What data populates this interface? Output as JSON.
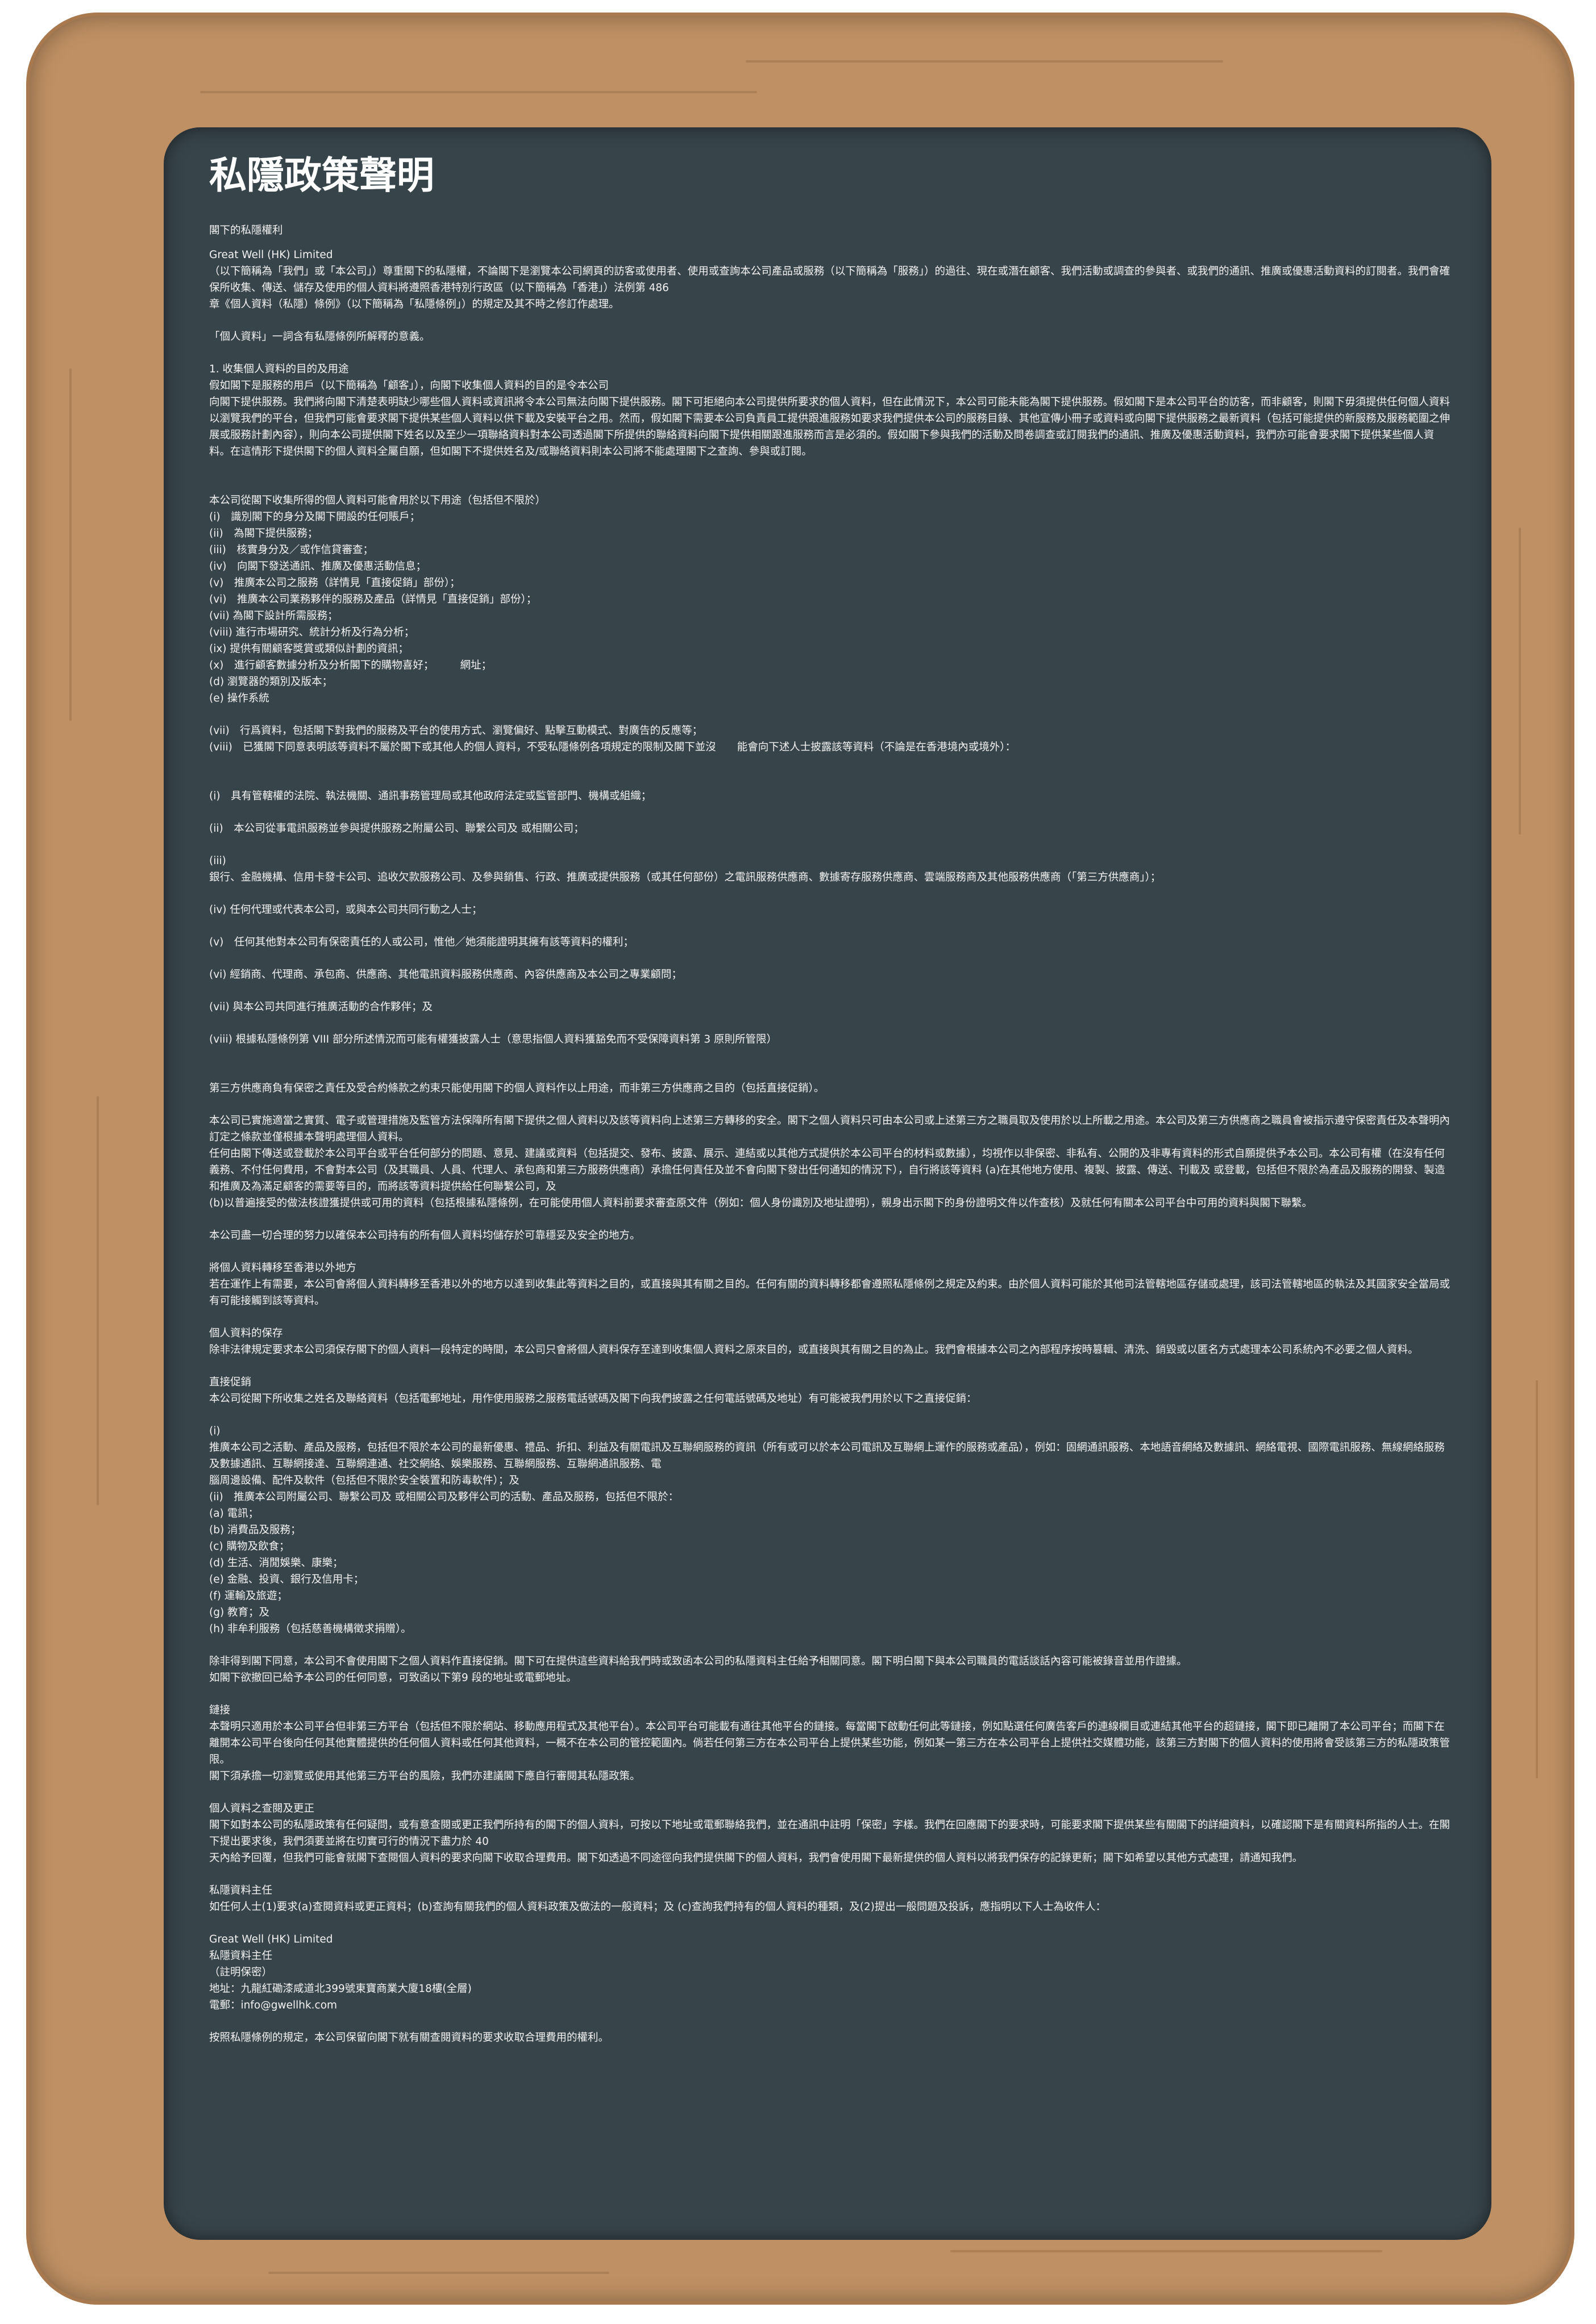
{
  "title": "私隱政策聲明",
  "blocks": [
    "閣下的私隱權利",
    "Great Well (HK) Limited\n（以下簡稱為「我們」或「本公司」）尊重閣下的私隱權，不論閣下是瀏覽本公司網頁的訪客或使用者、使用或查詢本公司產品或服務（以下簡稱為「服務」）的過往、現在或潛在顧客、我們活動或調查的參與者、或我們的通訊、推廣或優惠活動資料的訂閱者。我們會確保所收集、傳送、儲存及使用的個人資料將遵照香港特別行政區（以下簡稱為「香港」）法例第 486\n章《個人資料（私隱）條例》（以下簡稱為「私隱條例」）的規定及其不時之修訂作處理。",
    "「個人資料」一詞含有私隱條例所解釋的意義。",
    "1. 收集個人資料的目的及用途\n假如閣下是服務的用戶（以下簡稱為「顧客」），向閣下收集個人資料的目的是令本公司\n向閣下提供服務。我們將向閣下清楚表明缺少哪些個人資料或資訊將令本公司無法向閣下提供服務。閣下可拒絕向本公司提供所要求的個人資料，但在此情況下，本公司可能未能為閣下提供服務。假如閣下是本公司平台的訪客，而非顧客，則閣下毋須提供任何個人資料以瀏覽我們的平台，但我們可能會要求閣下提供某些個人資料以供下載及安裝平台之用。然而，假如閣下需要本公司負責員工提供跟進服務如要求我們提供本公司的服務目錄、其他宣傳小冊子或資料或向閣下提供服務之最新資料（包括可能提供的新服務及服務範圍之伸展或服務計劃內容），則向本公司提供閣下姓名以及至少一項聯絡資料對本公司透過閣下所提供的聯絡資料向閣下提供相關跟進服務而言是必須的。假如閣下參與我們的活動及問卷調查或訂閱我們的通訊、推廣及優惠活動資料，我們亦可能會要求閣下提供某些個人資料。在這情形下提供閣下的個人資料全屬自願，但如閣下不提供姓名及/或聯絡資料則本公司將不能處理閣下之查詢、參與或訂閱。",
    "\n本公司從閣下收集所得的個人資料可能會用於以下用途（包括但不限於）\n(i)　識別閣下的身分及閣下開設的任何賬戶；\n(ii)　為閣下提供服務；\n(iii)　核實身分及／或作信貸審查；\n(iv)　向閣下發送通訊、推廣及優惠活動信息；\n(v)　推廣本公司之服務（詳情見「直接促銷」部份）；\n(vi)　推廣本公司業務夥伴的服務及產品（詳情見「直接促銷」部份）；\n(vii) 為閣下設計所需服務；\n(viii) 進行市場研究、統計分析及行為分析；\n(ix) 提供有關顧客獎賞或類似計劃的資訊；\n(x)　進行顧客數據分析及分析閣下的購物喜好；　　　網址；\n(d) 瀏覽器的類別及版本；\n(e) 操作系統",
    "(vii)　行爲資料，包括閣下對我們的服務及平台的使用方式、瀏覽偏好、點擊互動模式、對廣告的反應等；\n(viii)　已獲閣下同意表明該等資料不屬於閣下或其他人的個人資料，不受私隱條例各項規定的限制及閣下並沒　　能會向下述人士披露該等資料（不論是在香港境內或境外）：",
    "\n(i)　具有管轄權的法院、執法機關、通訊事務管理局或其他政府法定或監管部門、機構或組織；",
    "(ii)　本公司從事電訊服務並參與提供服務之附屬公司、聯繫公司及 或相關公司；",
    "(iii)\n銀行、金融機構、信用卡發卡公司、追收欠款服務公司、及參與銷售、行政、推廣或提供服務（或其任何部份）之電訊服務供應商、數據寄存服務供應商、雲端服務商及其他服務供應商（「第三方供應商」）；",
    "(iv) 任何代理或代表本公司，或與本公司共同行動之人士；",
    "(v)　任何其他對本公司有保密責任的人或公司，惟他／她須能證明其擁有該等資料的權利；",
    "(vi) 經銷商、代理商、承包商、供應商、其他電訊資料服務供應商、內容供應商及本公司之專業顧問；",
    "(vii) 與本公司共同進行推廣活動的合作夥伴；及",
    "(viii) 根據私隱條例第 VIII 部分所述情況而可能有權獲披露人士（意思指個人資料獲豁免而不受保障資料第 3 原則所管限）",
    "\n第三方供應商負有保密之責任及受合約條款之約束只能使用閣下的個人資料作以上用途，而非第三方供應商之目的（包括直接促銷）。",
    "本公司已實施適當之實質、電子或管理措施及監管方法保障所有閣下提供之個人資料以及該等資料向上述第三方轉移的安全。閣下之個人資料只可由本公司或上述第三方之職員取及使用於以上所載之用途。本公司及第三方供應商之職員會被指示遵守保密責任及本聲明內訂定之條款並僅根據本聲明處理個人資料。\n任何由閣下傳送或登載於本公司平台或平台任何部分的問題、意見、建議或資料（包括提交、發布、披露、展示、連結或以其他方式提供於本公司平台的材料或數據），均視作以非保密、非私有、公開的及非專有資料的形式自願提供予本公司。本公司有權（在沒有任何義務、不付任何費用，不會對本公司（及其職員、人員、代理人、承包商和第三方服務供應商）承擔任何責任及並不會向閣下發出任何通知的情況下），自行將該等資料 (a)在其他地方使用、複製、披露、傳送、刊載及 或登載，包括但不限於為產品及服務的開發、製造和推廣及為滿足顧客的需要等目的，而將該等資料提供給任何聯繫公司，及\n(b)以普遍接受的做法核證獲提供或可用的資料（包括根據私隱條例，在可能使用個人資料前要求審查原文件（例如：個人身份識別及地址證明），親身出示閣下的身份證明文件以作查核）及就任何有關本公司平台中可用的資料與閣下聯繫。",
    "本公司盡一切合理的努力以確保本公司持有的所有個人資料均儲存於可靠穩妥及安全的地方。",
    "將個人資料轉移至香港以外地方\n若在運作上有需要，本公司會將個人資料轉移至香港以外的地方以達到收集此等資料之目的，或直接與其有關之目的。任何有關的資料轉移都會遵照私隱條例之規定及約束。由於個人資料可能於其他司法管轄地區存儲或處理，該司法管轄地區的執法及其國家安全當局或有可能接觸到該等資料。",
    "個人資料的保存\n除非法律規定要求本公司須保存閣下的個人資料一段特定的時間，本公司只會將個人資料保存至達到收集個人資料之原來目的，或直接與其有關之目的為止。我們會根據本公司之內部程序按時篡輯、清洗、銷毀或以匿名方式處理本公司系統內不必要之個人資料。",
    "直接促銷\n本公司從閣下所收集之姓名及聯絡資料（包括電郵地址，用作使用服務之服務電話號碼及閣下向我們披露之任何電話號碼及地址）有可能被我們用於以下之直接促銷：",
    "(i)\n推廣本公司之活動、產品及服務，包括但不限於本公司的最新優惠、禮品、折扣、利益及有關電訊及互聯網服務的資訊（所有或可以於本公司電訊及互聯網上運作的服務或產品），例如：固網通訊服務、本地語音網絡及數據訊、網絡電視、國際電訊服務、無線網絡服務及數據通訊、互聯網接達、互聯網連通、社交網絡、娛樂服務、互聯網服務、互聯網通訊服務、電\n腦周邊設備、配件及軟件（包括但不限於安全裝置和防毒軟件）；及\n(ii)　推廣本公司附屬公司、聯繫公司及 或相關公司及夥伴公司的活動、產品及服務，包括但不限於：\n(a) 電訊；\n(b) 消費品及服務；\n(c) 購物及飲食；\n(d) 生活、消閒娛樂、康樂；\n(e) 金融、投資、銀行及信用卡；\n(f) 運輸及旅遊；\n(g) 教育；及\n(h) 非牟利服務（包括慈善機構徵求捐贈）。",
    "除非得到閣下同意，本公司不會使用閣下之個人資料作直接促銷。閣下可在提供這些資料給我們時或致函本公司的私隱資料主任給予相關同意。閣下明白閣下與本公司職員的電話談話內容可能被錄音並用作證據。\n如閣下欲撤回已給予本公司的任何同意，可致函以下第9 段的地址或電郵地址。",
    "鏈接\n本聲明只適用於本公司平台但非第三方平台（包括但不限於網站、移動應用程式及其他平台）。本公司平台可能載有通往其他平台的鏈接。每當閣下啟動任何此等鏈接，例如點選任何廣告客戶的連線欄目或連結其他平台的超鏈接，閣下即已離開了本公司平台；而閣下在離開本公司平台後向任何其他實體提供的任何個人資料或任何其他資料，一概不在本公司的管控範圍內。倘若任何第三方在本公司平台上提供某些功能，例如某一第三方在本公司平台上提供社交媒體功能，該第三方對閣下的個人資料的使用將會受該第三方的私隱政策管限。\n閣下須承擔一切瀏覽或使用其他第三方平台的風險，我們亦建議閣下應自行審閱其私隱政策。",
    "個人資料之查閱及更正\n閣下如對本公司的私隱政策有任何疑問，或有意查閱或更正我們所持有的閣下的個人資料，可按以下地址或電郵聯絡我們，並在通訊中註明「保密」字樣。我們在回應閣下的要求時，可能要求閣下提供某些有關閣下的詳細資料，以確認閣下是有關資料所指的人士。在閣下提出要求後，我們須要並將在切實可行的情況下盡力於 40\n天內給予回覆，但我們可能會就閣下查閱個人資料的要求向閣下收取合理費用。閣下如透過不同途徑向我們提供閣下的個人資料，我們會使用閣下最新提供的個人資料以將我們保存的記錄更新；閣下如希望以其他方式處理，請通知我們。",
    "私隱資料主任\n如任何人士(1)要求(a)查閱資料或更正資料；(b)查詢有關我們的個人資料政策及做法的一般資料；及 (c)查詢我們持有的個人資料的種類，及(2)提出一般問題及投訴，應指明以下人士為收件人：",
    "Great Well (HK) Limited\n私隱資料主任\n（註明保密）\n地址：九龍紅磡漆咸道北399號東寶商業大廈18樓(全層)\n電郵：info@gwellhk.com",
    "按照私隱條例的規定，本公司保留向閣下就有關查閱資料的要求收取合理費用的權利。"
  ]
}
